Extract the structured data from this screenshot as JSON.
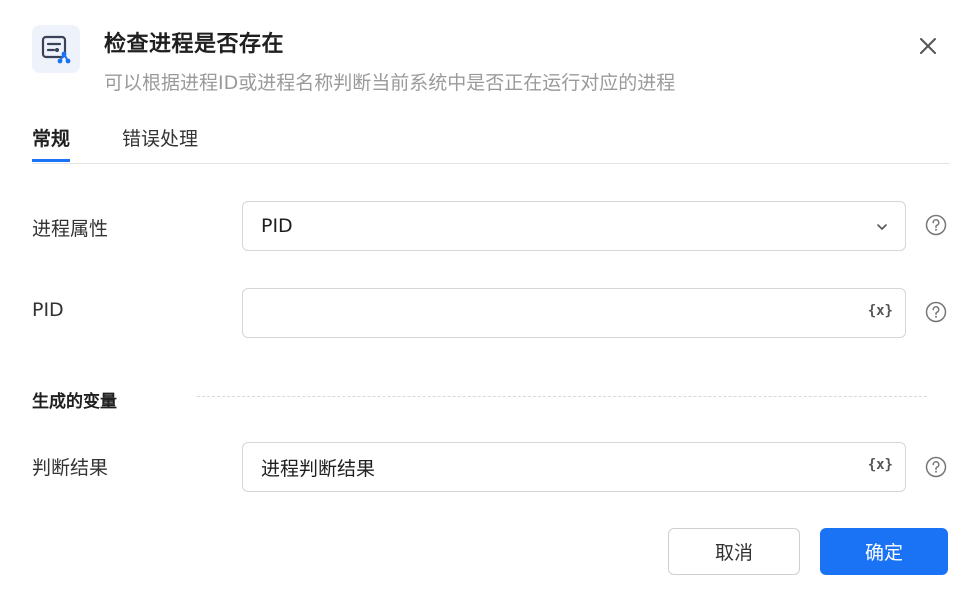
{
  "dialog": {
    "title": "检查进程是否存在",
    "subtitle": "可以根据进程ID或进程名称判断当前系统中是否正在运行对应的进程",
    "icon": "process-check-icon",
    "accent_color": "#1a73f5"
  },
  "tabs": [
    {
      "label": "常规",
      "active": true
    },
    {
      "label": "错误处理",
      "active": false
    }
  ],
  "form": {
    "process_attr": {
      "label": "进程属性",
      "value": "PID"
    },
    "pid": {
      "label": "PID",
      "value": "",
      "var_button": "{x}"
    },
    "section_title": "生成的变量",
    "result": {
      "label": "判断结果",
      "value": "进程判断结果",
      "var_button": "{x}"
    }
  },
  "footer": {
    "cancel_label": "取消",
    "confirm_label": "确定"
  }
}
